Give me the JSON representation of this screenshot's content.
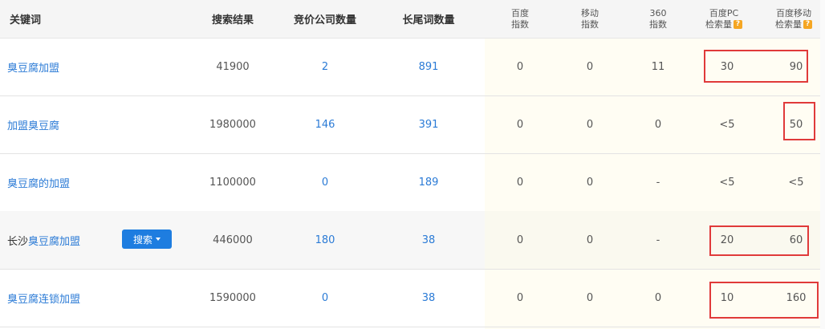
{
  "headers": {
    "keyword": "关键词",
    "results": "搜索结果",
    "bid_companies": "竞价公司数量",
    "longtail": "长尾词数量",
    "baidu_index_1": "百度",
    "baidu_index_2": "指数",
    "mobile_index_1": "移动",
    "mobile_index_2": "指数",
    "idx360_1": "360",
    "idx360_2": "指数",
    "pc_volume_1": "百度PC",
    "pc_volume_2": "检索量",
    "mobile_volume_1": "百度移动",
    "mobile_volume_2": "检索量",
    "help_mark": "?"
  },
  "rows": [
    {
      "keyword": "臭豆腐加盟",
      "results": "41900",
      "bid": "2",
      "longtail": "891",
      "baidu": "0",
      "mobile": "0",
      "idx360": "11",
      "pc": "30",
      "mob": "90"
    },
    {
      "keyword": "加盟臭豆腐",
      "results": "1980000",
      "bid": "146",
      "longtail": "391",
      "baidu": "0",
      "mobile": "0",
      "idx360": "0",
      "pc": "<5",
      "mob": "50"
    },
    {
      "keyword": "臭豆腐的加盟",
      "results": "1100000",
      "bid": "0",
      "longtail": "189",
      "baidu": "0",
      "mobile": "0",
      "idx360": "-",
      "pc": "<5",
      "mob": "<5"
    },
    {
      "keyword_prefix": "长沙",
      "keyword": "臭豆腐加盟",
      "results": "446000",
      "bid": "180",
      "longtail": "38",
      "baidu": "0",
      "mobile": "0",
      "idx360": "-",
      "pc": "20",
      "mob": "60"
    },
    {
      "keyword": "臭豆腐连锁加盟",
      "results": "1590000",
      "bid": "0",
      "longtail": "38",
      "baidu": "0",
      "mobile": "0",
      "idx360": "0",
      "pc": "10",
      "mob": "160"
    }
  ],
  "search_button": "搜索",
  "colors": {
    "link": "#2b7bd6",
    "button": "#1e7de0",
    "highlight_box": "#e03a3a",
    "help_badge": "#f5a623"
  }
}
